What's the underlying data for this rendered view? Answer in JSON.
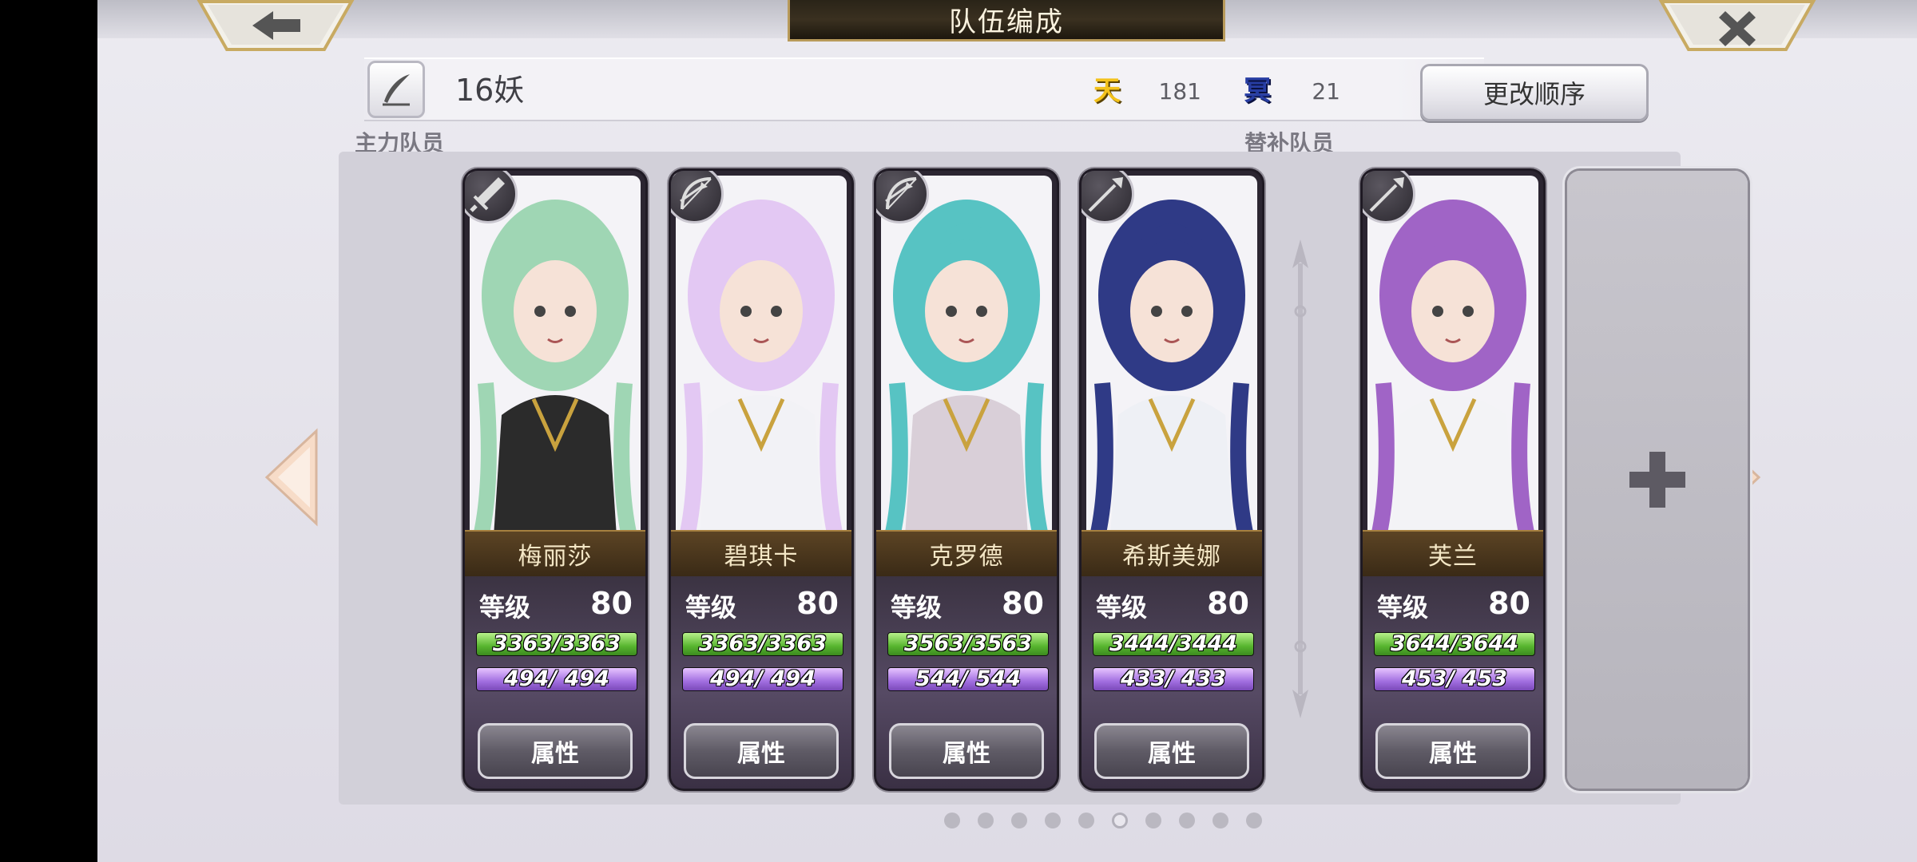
{
  "header": {
    "title": "队伍编成",
    "back_icon": "back-arrow-icon",
    "close_icon": "close-x-icon"
  },
  "team": {
    "name": "16妖",
    "tian_label": "天",
    "tian_value": "181",
    "ming_label": "冥",
    "ming_value": "21",
    "reorder_label": "更改顺序"
  },
  "sections": {
    "main": "主力队员",
    "sub": "替补队员"
  },
  "members": [
    {
      "name": "梅丽莎",
      "level_label": "等级",
      "level": "80",
      "hp": "3363/3363",
      "hp_ratio": 1.0,
      "sp": "494/ 494",
      "sp_ratio": 1.0,
      "button": "属性",
      "weapon": "sword-icon",
      "hair": "#9fd6b4",
      "outfit": "#2b2b2b"
    },
    {
      "name": "碧琪卡",
      "level_label": "等级",
      "level": "80",
      "hp": "3363/3363",
      "hp_ratio": 1.0,
      "sp": "494/ 494",
      "sp_ratio": 1.0,
      "button": "属性",
      "weapon": "bow-icon",
      "hair": "#e3c8f3",
      "outfit": "#f2f2f6"
    },
    {
      "name": "克罗德",
      "level_label": "等级",
      "level": "80",
      "hp": "3563/3563",
      "hp_ratio": 1.0,
      "sp": "544/ 544",
      "sp_ratio": 1.0,
      "button": "属性",
      "weapon": "bow-icon",
      "hair": "#57c3c3",
      "outfit": "#d9cfd8"
    },
    {
      "name": "希斯美娜",
      "level_label": "等级",
      "level": "80",
      "hp": "3444/3444",
      "hp_ratio": 1.0,
      "sp": "433/ 433",
      "sp_ratio": 1.0,
      "button": "属性",
      "weapon": "spear-icon",
      "hair": "#2f3a86",
      "outfit": "#eef0f5"
    }
  ],
  "reserves": [
    {
      "name": "芙兰",
      "level_label": "等级",
      "level": "80",
      "hp": "3644/3644",
      "hp_ratio": 1.0,
      "sp": "453/ 453",
      "sp_ratio": 1.0,
      "button": "属性",
      "weapon": "spear-icon",
      "hair": "#a064c6",
      "outfit": "#f3f3f6"
    }
  ],
  "empty_slot_icon": "plus-icon",
  "pager": {
    "count": 10,
    "active": 5
  }
}
